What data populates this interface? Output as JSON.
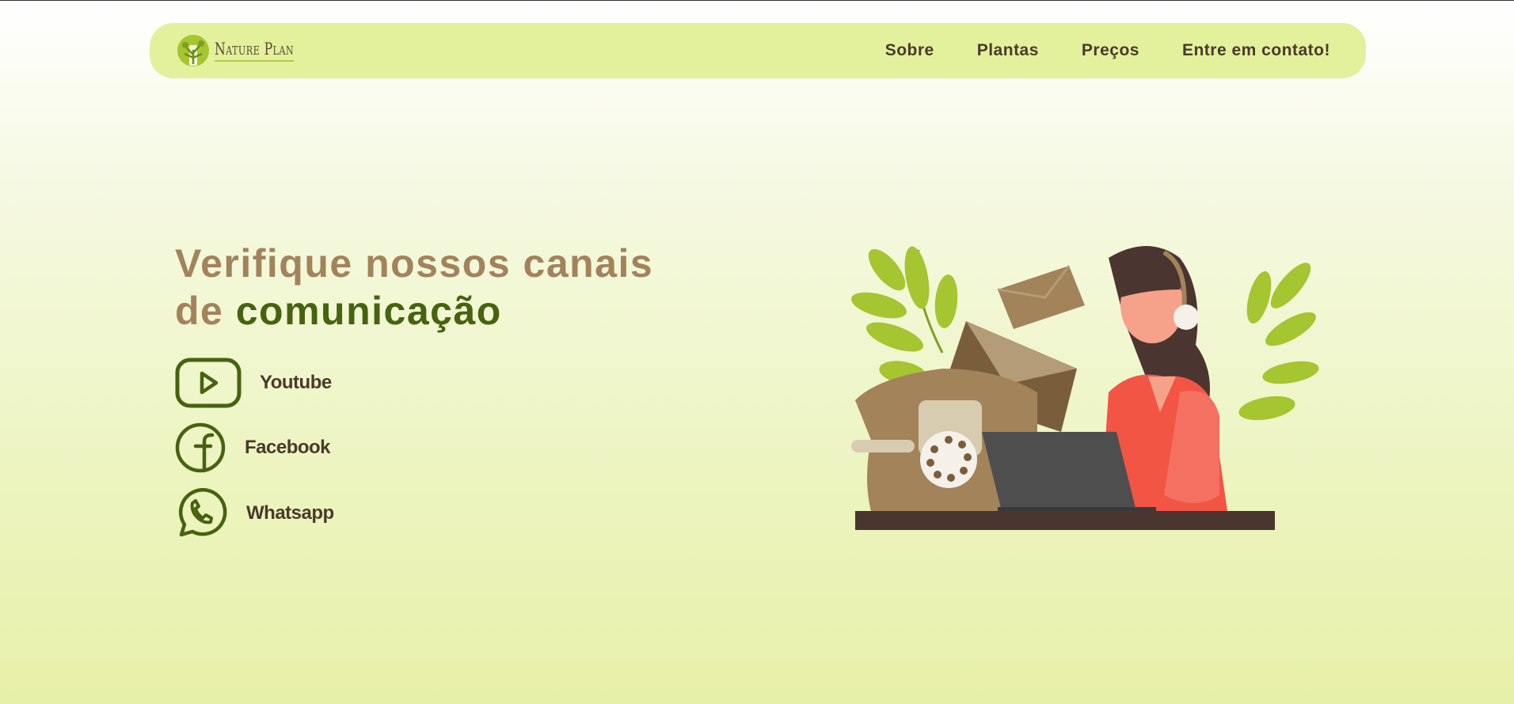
{
  "brand": {
    "name": "Nature Plan",
    "icon": "tree-icon"
  },
  "nav": {
    "items": [
      {
        "label": "Sobre"
      },
      {
        "label": "Plantas"
      },
      {
        "label": "Preços"
      },
      {
        "label": "Entre em contato!"
      }
    ]
  },
  "hero": {
    "title_line1": "Verifique nossos canais",
    "title_line2_prefix": "de ",
    "title_line2_accent": "comunicação"
  },
  "social": [
    {
      "label": "Youtube",
      "icon": "youtube-icon"
    },
    {
      "label": "Facebook",
      "icon": "facebook-icon"
    },
    {
      "label": "Whatsapp",
      "icon": "whatsapp-icon"
    }
  ],
  "colors": {
    "nav_bg": "#e3f09c",
    "title_brown": "#a3835a",
    "title_green": "#46630f",
    "text_dark": "#4a3a2a"
  },
  "illustration": "customer-support-illustration"
}
